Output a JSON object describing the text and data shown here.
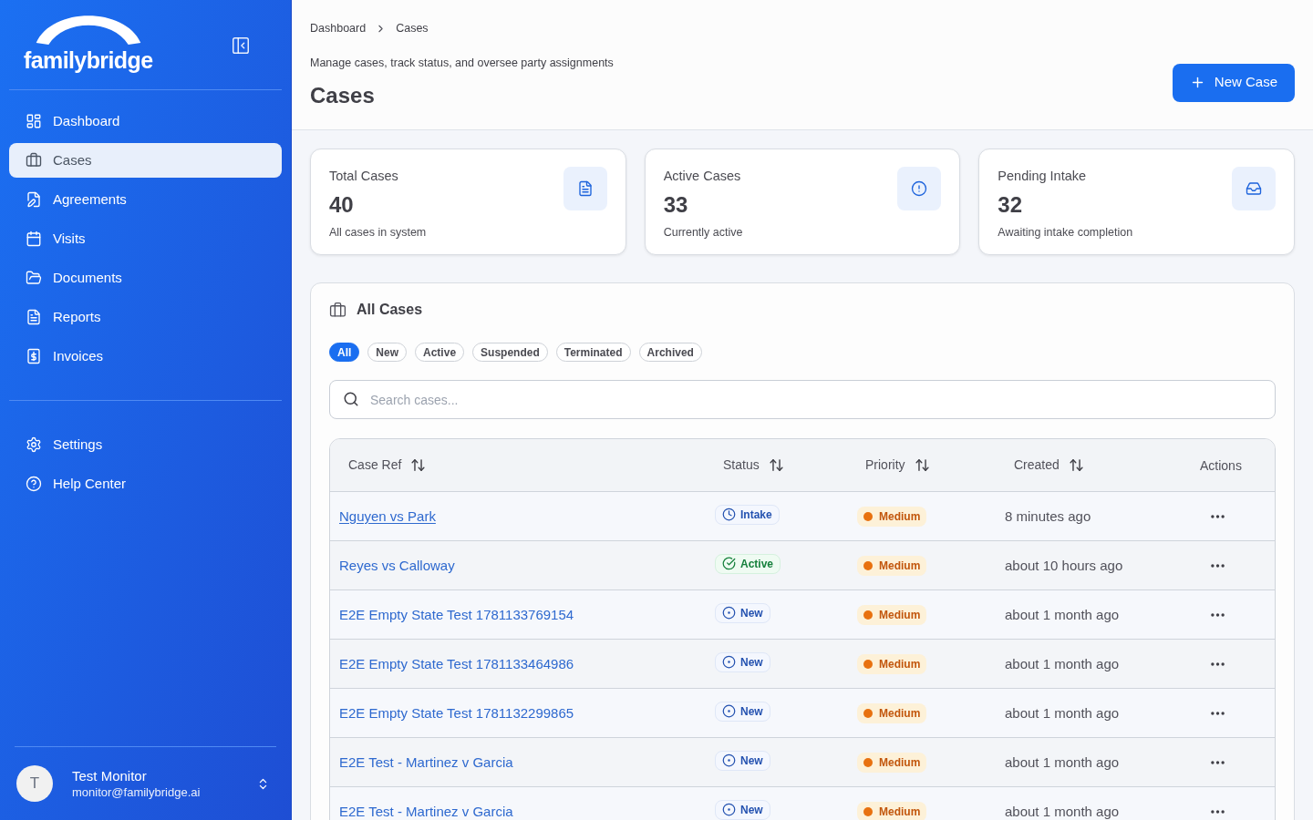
{
  "sidebar": {
    "logo": "familybridge",
    "nav_items": [
      {
        "label": "Dashboard",
        "selected": false
      },
      {
        "label": "Cases",
        "selected": true
      },
      {
        "label": "Agreements",
        "selected": false
      },
      {
        "label": "Visits",
        "selected": false
      },
      {
        "label": "Documents",
        "selected": false
      },
      {
        "label": "Reports",
        "selected": false
      },
      {
        "label": "Invoices",
        "selected": false
      }
    ],
    "secondary_items": [
      {
        "label": "Settings",
        "selected": false
      },
      {
        "label": "Help Center",
        "selected": false
      }
    ],
    "user": {
      "initial": "T",
      "name": "Test Monitor",
      "email": "monitor@familybridge.ai"
    }
  },
  "header": {
    "breadcrumb": [
      "Dashboard",
      "Cases"
    ],
    "description": "Manage cases, track status, and oversee party assignments",
    "title": "Cases",
    "new_button": "New Case"
  },
  "stats": [
    {
      "title": "Total Cases",
      "value": "40",
      "caption": "All cases in system"
    },
    {
      "title": "Active Cases",
      "value": "33",
      "caption": "Currently active"
    },
    {
      "title": "Pending Intake",
      "value": "32",
      "caption": "Awaiting intake completion"
    }
  ],
  "cases_panel": {
    "title": "All Cases",
    "filters": [
      {
        "label": "All",
        "selected": true
      },
      {
        "label": "New",
        "selected": false
      },
      {
        "label": "Active",
        "selected": false
      },
      {
        "label": "Suspended",
        "selected": false
      },
      {
        "label": "Terminated",
        "selected": false
      },
      {
        "label": "Archived",
        "selected": false
      }
    ],
    "search": {
      "placeholder": "Search cases..."
    },
    "table": {
      "columns": [
        {
          "label": "Case Ref",
          "sortable": true
        },
        {
          "label": "Status",
          "sortable": true
        },
        {
          "label": "Priority",
          "sortable": true
        },
        {
          "label": "Created",
          "sortable": true
        },
        {
          "label": "Actions",
          "sortable": false
        }
      ],
      "rows": [
        {
          "case_ref": "Nguyen vs Park",
          "hovered": true,
          "status": {
            "label": "Intake",
            "kind": "intake"
          },
          "priority": {
            "label": "Medium",
            "kind": "medium"
          },
          "created": "8 minutes ago"
        },
        {
          "case_ref": "Reyes vs Calloway",
          "hovered": false,
          "status": {
            "label": "Active",
            "kind": "active"
          },
          "priority": {
            "label": "Medium",
            "kind": "medium"
          },
          "created": "about 10 hours ago"
        },
        {
          "case_ref": "E2E Empty State Test 1781133769154",
          "hovered": false,
          "status": {
            "label": "New",
            "kind": "new"
          },
          "priority": {
            "label": "Medium",
            "kind": "medium"
          },
          "created": "about 1 month ago"
        },
        {
          "case_ref": "E2E Empty State Test 1781133464986",
          "hovered": false,
          "status": {
            "label": "New",
            "kind": "new"
          },
          "priority": {
            "label": "Medium",
            "kind": "medium"
          },
          "created": "about 1 month ago"
        },
        {
          "case_ref": "E2E Empty State Test 1781132299865",
          "hovered": false,
          "status": {
            "label": "New",
            "kind": "new"
          },
          "priority": {
            "label": "Medium",
            "kind": "medium"
          },
          "created": "about 1 month ago"
        },
        {
          "case_ref": "E2E Test - Martinez v Garcia",
          "hovered": false,
          "status": {
            "label": "New",
            "kind": "new"
          },
          "priority": {
            "label": "Medium",
            "kind": "medium"
          },
          "created": "about 1 month ago"
        },
        {
          "case_ref": "E2E Test - Martinez v Garcia",
          "hovered": false,
          "status": {
            "label": "New",
            "kind": "new"
          },
          "priority": {
            "label": "Medium",
            "kind": "medium"
          },
          "created": "about 1 month ago"
        }
      ]
    }
  }
}
